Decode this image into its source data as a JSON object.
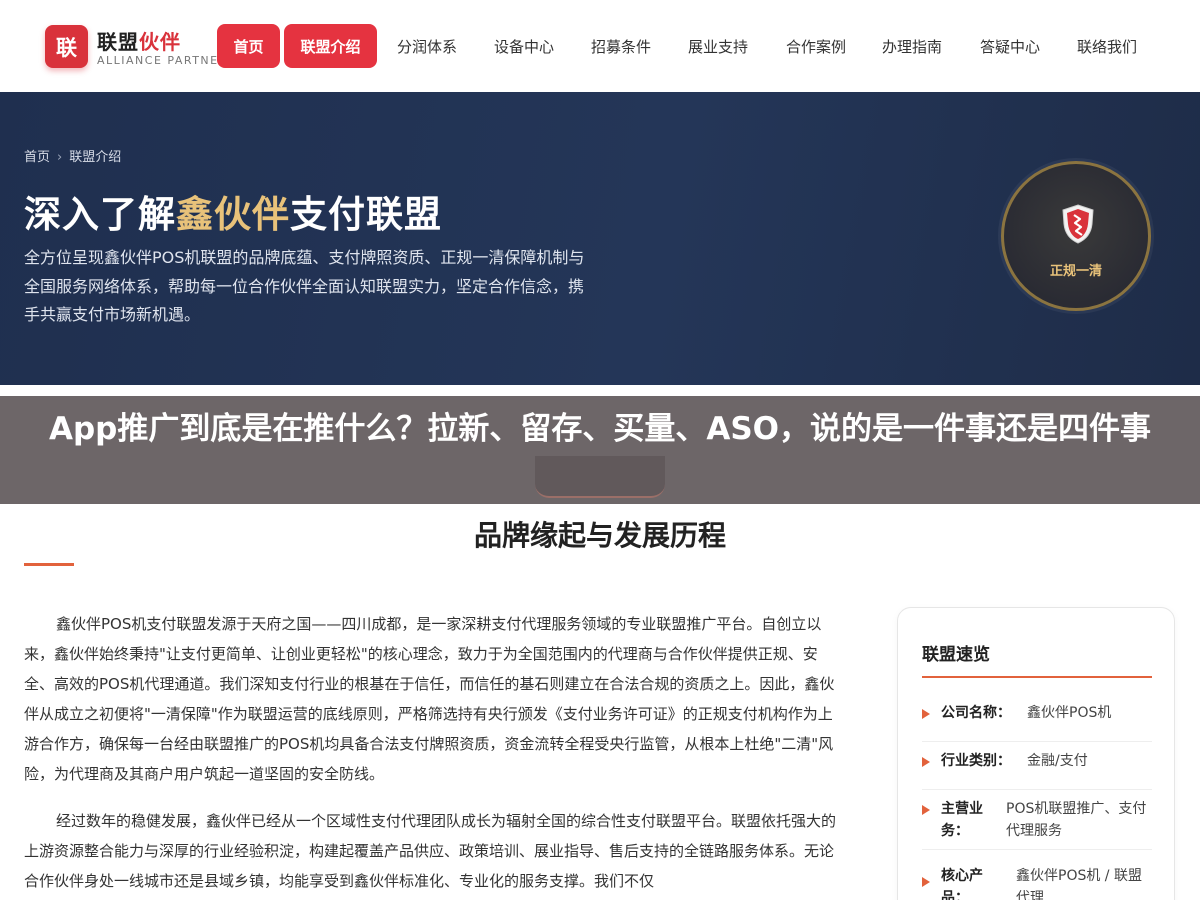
{
  "brand": {
    "logo_char": "联",
    "name_part1": "联盟",
    "name_part2": "伙伴",
    "subtitle": "ALLIANCE PARTNER",
    "accent_color": "#d9323b"
  },
  "nav": {
    "home": "首页",
    "about": "联盟介绍",
    "items": [
      "分润体系",
      "设备中心",
      "招募条件",
      "展业支持",
      "合作案例",
      "办理指南",
      "答疑中心",
      "联络我们"
    ]
  },
  "hero": {
    "breadcrumb": [
      "首页",
      "联盟介绍"
    ],
    "breadcrumb_sep": "›",
    "title_prefix": "深入了解",
    "title_highlight": "鑫伙伴",
    "title_suffix": "支付联盟",
    "description": "全方位呈现鑫伙伴POS机联盟的品牌底蕴、支付牌照资质、正规一清保障机制与全国服务网络体系，帮助每一位合作伙伴全面认知联盟实力，坚定合作信念，携手共赢支付市场新机遇。",
    "badge_text": "正规一清",
    "badge_icon": "shield-icon"
  },
  "article": {
    "title": "App推广到底是在推什么？拉新、留存、买量、ASO，说的是一件事还是四件事"
  },
  "section": {
    "title": "品牌缘起与发展历程",
    "para1": "鑫伙伴POS机支付联盟发源于天府之国——四川成都，是一家深耕支付代理服务领域的专业联盟推广平台。自创立以来，鑫伙伴始终秉持\"让支付更简单、让创业更轻松\"的核心理念，致力于为全国范围内的代理商与合作伙伴提供正规、安全、高效的POS机代理通道。我们深知支付行业的根基在于信任，而信任的基石则建立在合法合规的资质之上。因此，鑫伙伴从成立之初便将\"一清保障\"作为联盟运营的底线原则，严格筛选持有央行颁发《支付业务许可证》的正规支付机构作为上游合作方，确保每一台经由联盟推广的POS机均具备合法支付牌照资质，资金流转全程受央行监管，从根本上杜绝\"二清\"风险，为代理商及其商户用户筑起一道坚固的安全防线。",
    "para2": "经过数年的稳健发展，鑫伙伴已经从一个区域性支付代理团队成长为辐射全国的综合性支付联盟平台。联盟依托强大的上游资源整合能力与深厚的行业经验积淀，构建起覆盖产品供应、政策培训、展业指导、售后支持的全链路服务体系。无论合作伙伴身处一线城市还是县域乡镇，均能享受到鑫伙伴标准化、专业化的服务支撑。我们不仅"
  },
  "sidebar": {
    "title": "联盟速览",
    "items": [
      {
        "key": "公司名称：",
        "value": "鑫伙伴POS机"
      },
      {
        "key": "行业类别：",
        "value": "金融/支付"
      },
      {
        "key_line1": "主营业",
        "key_line2": "务：",
        "value": "POS机联盟推广、支付代理服务"
      },
      {
        "key_line1": "核心产",
        "key_line2": "品：",
        "value": "鑫伙伴POS机 / 联盟代理"
      }
    ]
  }
}
